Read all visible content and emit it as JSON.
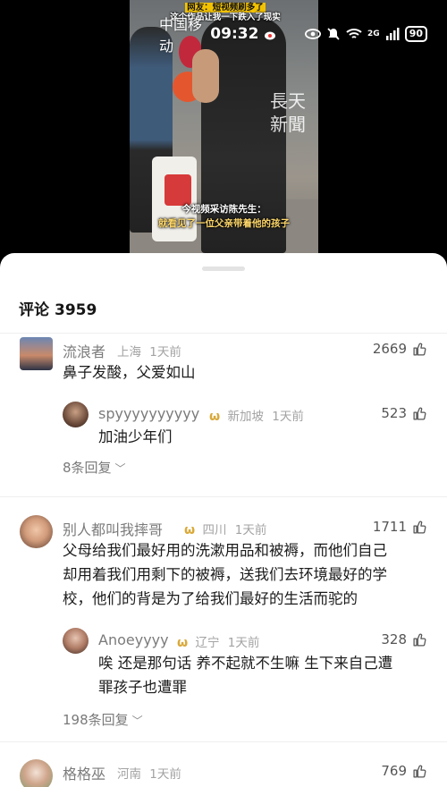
{
  "video": {
    "top_caption_line1": "网友：短视频刷多了",
    "top_caption_line2": "这个作品让我一下跌入了现实",
    "watermark": "長天新聞",
    "subtitle_line1": "今视频采访陈先生：",
    "subtitle_line2": "就看见了一位父亲带着他的孩子"
  },
  "status_bar": {
    "carrier": "中国移动",
    "time": "09:32",
    "network": "2G",
    "battery": "90"
  },
  "comments_header": {
    "label": "评论",
    "count": "3959"
  },
  "comments": [
    {
      "username": "流浪者",
      "location": "上海",
      "time": "1天前",
      "likes": "2669",
      "text": "鼻子发酸，父爱如山",
      "reply": {
        "username": "spyyyyyyyyyy",
        "location": "新加坡",
        "time": "1天前",
        "likes": "523",
        "text": "加油少年们"
      },
      "more_replies": "8条回复"
    },
    {
      "username": "别人都叫我摔哥",
      "location": "四川",
      "time": "1天前",
      "likes": "1711",
      "text_line1": "父母给我们最好用的洗漱用品和被褥，而他们自己",
      "text_line2": "却用着我们用剩下的被褥，送我们去环境最好的学",
      "text_line3": "校，他们的背是为了给我们最好的生活而驼的",
      "reply": {
        "username": "Anoeyyyy",
        "location": "辽宁",
        "time": "1天前",
        "likes": "328",
        "text_line1": "唉 还是那句话 养不起就不生嘛 生下来自己遭",
        "text_line2": "罪孩子也遭罪"
      },
      "more_replies": "198条回复"
    },
    {
      "username": "格格巫",
      "location": "河南",
      "time": "1天前",
      "likes": "769"
    }
  ],
  "badge_icon": "ω",
  "icons": {
    "like": "thumbs-up-icon",
    "chevron": "chevron-down-icon"
  }
}
